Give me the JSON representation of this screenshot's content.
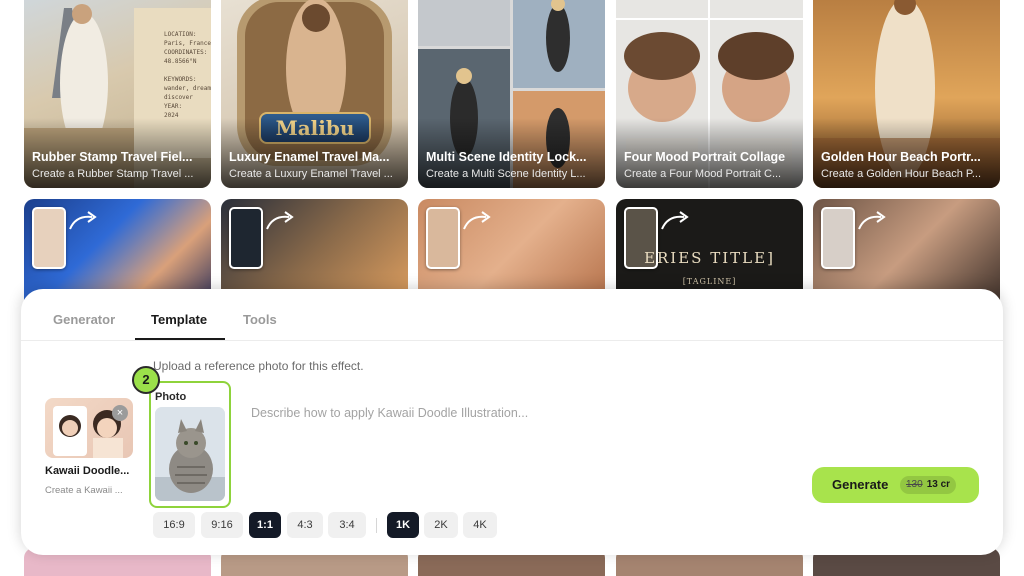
{
  "gallery": {
    "top_row": [
      {
        "title": "Rubber Stamp Travel Fiel...",
        "desc": "Create a Rubber Stamp Travel ..."
      },
      {
        "title": "Luxury Enamel Travel Ma...",
        "desc": "Create a Luxury Enamel Travel ..."
      },
      {
        "title": "Multi Scene Identity Lock...",
        "desc": "Create a Multi Scene Identity L..."
      },
      {
        "title": "Four Mood Portrait Collage",
        "desc": "Create a Four Mood Portrait C..."
      },
      {
        "title": "Golden Hour Beach Portr...",
        "desc": "Create a Golden Hour Beach P..."
      }
    ],
    "stamp_lines": "LOCATION:\nParis, France\nCOORDINATES:\n48.8566°N\n\nKEYWORDS:\nwander, dream,\ndiscover\nYEAR:\n2024",
    "enamel_badge": "Malibu",
    "mock_title": "ERIES TITLE]",
    "mock_tagline": "[TAGLINE]"
  },
  "tabs": [
    {
      "label": "Generator",
      "active": false
    },
    {
      "label": "Template",
      "active": true
    },
    {
      "label": "Tools",
      "active": false
    }
  ],
  "hint": "Upload a reference photo for this effect.",
  "template": {
    "name": "Kawaii Doodle...",
    "desc": "Create a Kawaii ..."
  },
  "step_badge": "2",
  "photo_slot": {
    "label": "Photo"
  },
  "prompt": {
    "placeholder": "Describe how to apply Kawaii Doodle Illustration...",
    "value": ""
  },
  "generate": {
    "label": "Generate",
    "old_price": "130",
    "price": "13 cr"
  },
  "aspect_ratios": [
    {
      "label": "16:9",
      "selected": false
    },
    {
      "label": "9:16",
      "selected": false
    },
    {
      "label": "1:1",
      "selected": true
    },
    {
      "label": "4:3",
      "selected": false
    },
    {
      "label": "3:4",
      "selected": false
    }
  ],
  "resolutions": [
    {
      "label": "1K",
      "selected": true
    },
    {
      "label": "2K",
      "selected": false
    },
    {
      "label": "4K",
      "selected": false
    }
  ],
  "colors": {
    "accent_green": "#a8e34c",
    "selected_dark": "#141a27",
    "photo_border": "#8ed33b"
  }
}
